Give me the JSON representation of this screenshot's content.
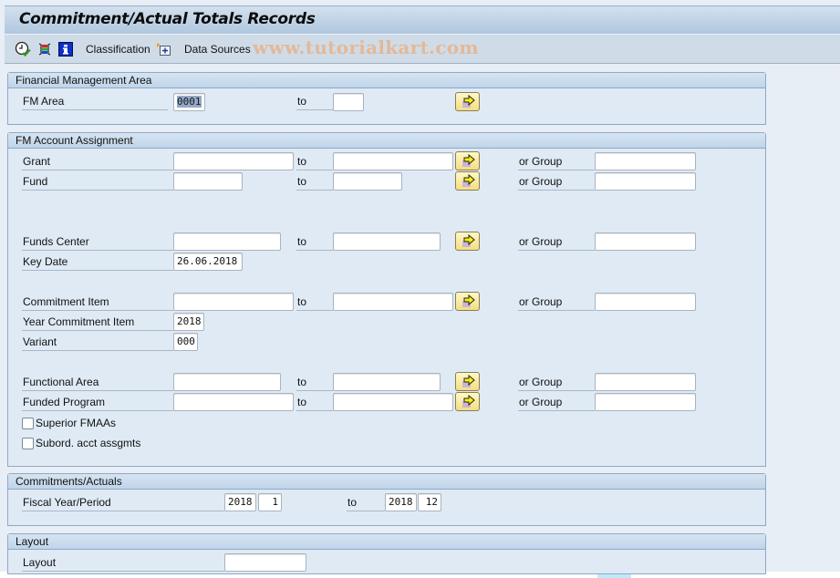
{
  "title": "Commitment/Actual Totals Records",
  "toolbar": {
    "items": [
      {
        "icon": "execute-clock-icon"
      },
      {
        "icon": "color-legend-icon"
      },
      {
        "icon": "info-icon"
      },
      {
        "label": "Classification"
      },
      {
        "icon": "data-sources-icon"
      },
      {
        "label": "Data Sources"
      }
    ],
    "classification_label": "Classification",
    "data_sources_label": "Data Sources",
    "watermark": "www.tutorialkart.com"
  },
  "groups": {
    "fm_area": {
      "title": "Financial Management Area",
      "fm_area": {
        "label": "FM Area",
        "from": "0001",
        "to_label": "to",
        "to": ""
      }
    },
    "account_assignment": {
      "title": "FM Account Assignment",
      "grant": {
        "label": "Grant",
        "from": "",
        "to_label": "to",
        "to": "",
        "group_label": "or Group",
        "group": ""
      },
      "fund": {
        "label": "Fund",
        "from": "",
        "to_label": "to",
        "to": "",
        "group_label": "or Group",
        "group": ""
      },
      "funds_center": {
        "label": "Funds Center",
        "from": "",
        "to_label": "to",
        "to": "",
        "group_label": "or Group",
        "group": ""
      },
      "key_date": {
        "label": "Key Date",
        "value": "26.06.2018"
      },
      "commitment_item": {
        "label": "Commitment Item",
        "from": "",
        "to_label": "to",
        "to": "",
        "group_label": "or Group",
        "group": ""
      },
      "year_commitment_item": {
        "label": "Year Commitment Item",
        "value": "2018"
      },
      "variant": {
        "label": "Variant",
        "value": "000"
      },
      "functional_area": {
        "label": "Functional Area",
        "from": "",
        "to_label": "to",
        "to": "",
        "group_label": "or Group",
        "group": ""
      },
      "funded_program": {
        "label": "Funded Program",
        "from": "",
        "to_label": "to",
        "to": "",
        "group_label": "or Group",
        "group": ""
      },
      "superior_fmaas": {
        "label": "Superior FMAAs",
        "checked": false
      },
      "subord_acct": {
        "label": "Subord. acct assgmts",
        "checked": false
      }
    },
    "commitments": {
      "title": "Commitments/Actuals",
      "fiscal": {
        "label": "Fiscal Year/Period",
        "from_year": "2018",
        "from_period": "1",
        "to_label": "to",
        "to_year": "2018",
        "to_period": "12"
      }
    },
    "layout": {
      "title": "Layout",
      "layout": {
        "label": "Layout",
        "value": ""
      }
    }
  }
}
